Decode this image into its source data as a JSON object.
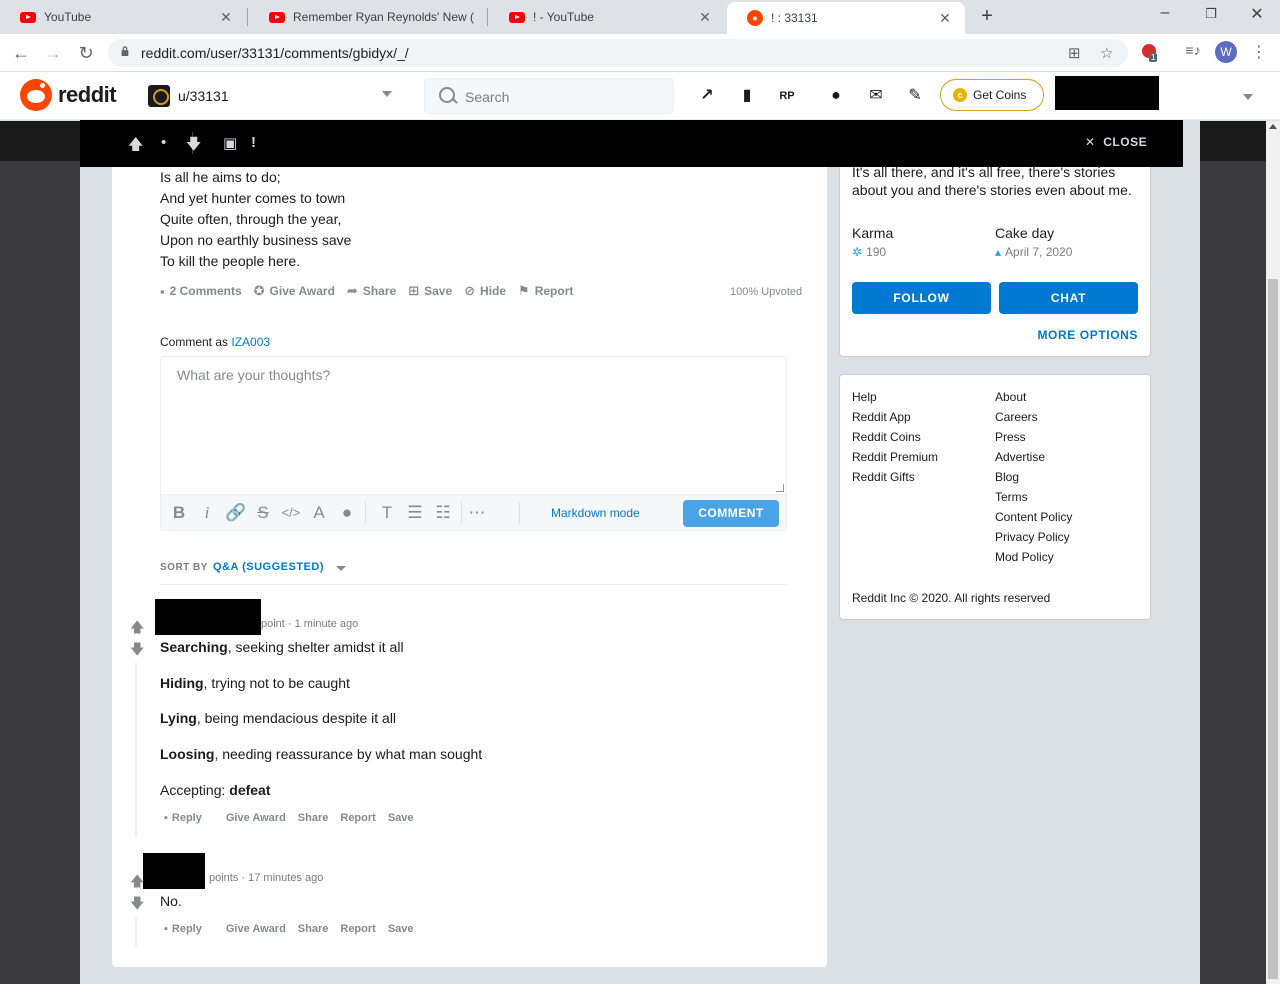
{
  "browser": {
    "tabs": [
      {
        "title": "YouTube",
        "icon": "youtube-icon"
      },
      {
        "title": "Remember Ryan Reynolds' New (",
        "icon": "youtube-icon"
      },
      {
        "title": "! - YouTube",
        "icon": "youtube-icon"
      },
      {
        "title": "! : 33131",
        "icon": "reddit-icon"
      }
    ],
    "url": "reddit.com/user/33131/comments/gbidyx/_/",
    "profile_initial": "W",
    "ext_badge": "1"
  },
  "header": {
    "wordmark": "reddit",
    "user": "u/33131",
    "search_placeholder": "Search",
    "get_coins": "Get Coins"
  },
  "postbar": {
    "dot": "•",
    "title": "!",
    "close": "CLOSE"
  },
  "post": {
    "poem": [
      "Is all he aims to do;",
      "And yet hunter comes to town",
      "Quite often, through the year,",
      "Upon no earthly business save",
      "To kill the people here."
    ],
    "actions": {
      "comments": "2 Comments",
      "award": "Give Award",
      "share": "Share",
      "save": "Save",
      "hide": "Hide",
      "report": "Report"
    },
    "upvoted": "100% Upvoted"
  },
  "composer": {
    "comment_as_label": "Comment as",
    "username": "IZA003",
    "placeholder": "What are your thoughts?",
    "markdown_mode": "Markdown mode",
    "submit": "COMMENT"
  },
  "sort": {
    "label": "SORT BY",
    "value": "Q&A (SUGGESTED)"
  },
  "comments": [
    {
      "meta": "point · 1 minute ago",
      "lines": [
        {
          "bold": "Searching",
          "rest": ", seeking shelter amidst it all"
        },
        {
          "bold": "Hiding",
          "rest": ", trying not to be caught"
        },
        {
          "bold": "Lying",
          "rest": ", being mendacious despite it all"
        },
        {
          "bold": "Loosing",
          "rest": ", needing reassurance by what man sought"
        },
        {
          "pre": "Accepting: ",
          "bold": "defeat"
        }
      ],
      "actions": [
        "Reply",
        "Give Award",
        "Share",
        "Report",
        "Save"
      ]
    },
    {
      "meta": "points · 17 minutes ago",
      "lines": [
        {
          "rest": "No."
        }
      ],
      "actions": [
        "Reply",
        "Give Award",
        "Share",
        "Report",
        "Save"
      ]
    }
  ],
  "sidebar": {
    "bio": "It's all there, and it's all free, there's stories about you and there's stories even about me.",
    "karma_label": "Karma",
    "karma_value": "190",
    "cakeday_label": "Cake day",
    "cakeday_value": "April 7, 2020",
    "follow": "FOLLOW",
    "chat": "CHAT",
    "more_options": "MORE OPTIONS",
    "links_left": [
      "Help",
      "Reddit App",
      "Reddit Coins",
      "Reddit Premium",
      "Reddit Gifts"
    ],
    "links_right": [
      "About",
      "Careers",
      "Press",
      "Advertise",
      "Blog",
      "Terms",
      "Content Policy",
      "Privacy Policy",
      "Mod Policy"
    ],
    "copyright": "Reddit Inc © 2020. All rights reserved"
  },
  "colors": {
    "accent": "#0079d3",
    "reddit_orange": "#ff4500"
  }
}
